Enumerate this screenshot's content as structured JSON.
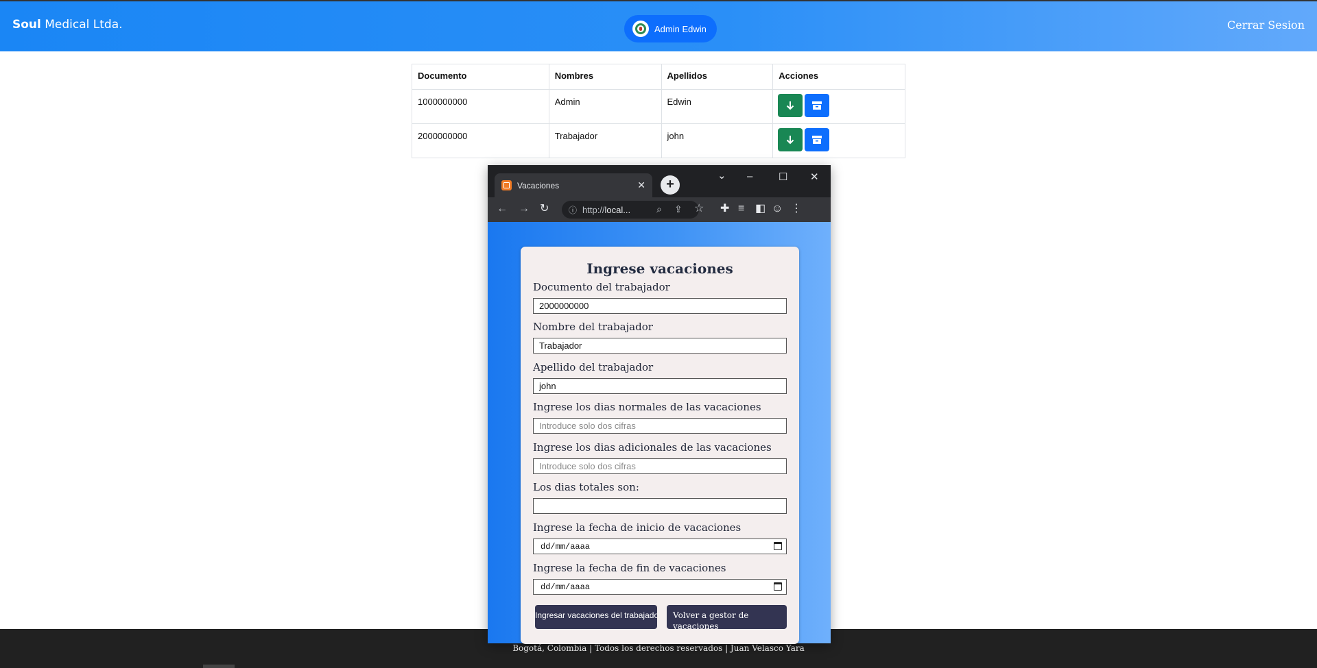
{
  "header": {
    "brand_bold": "Soul",
    "brand_rest": " Medical Ltda.",
    "user_label": "Admin Edwin",
    "logout_label": "Cerrar Sesion"
  },
  "table": {
    "headers": [
      "Documento",
      "Nombres",
      "Apellidos",
      "Acciones"
    ],
    "rows": [
      {
        "documento": "1000000000",
        "nombres": "Admin",
        "apellidos": "Edwin"
      },
      {
        "documento": "2000000000",
        "nombres": "Trabajador",
        "apellidos": "john"
      }
    ]
  },
  "browser": {
    "tab_title": "Vacaciones",
    "url_prefix": "http://",
    "url_host": "local..."
  },
  "form": {
    "title": "Ingrese vacaciones",
    "documento_label": "Documento del trabajador",
    "documento_value": "2000000000",
    "nombre_label": "Nombre del trabajador",
    "nombre_value": "Trabajador",
    "apellido_label": "Apellido del trabajador",
    "apellido_value": "john",
    "dias_normales_label": "Ingrese los dias normales de las vacaciones",
    "dias_normales_placeholder": "Introduce solo dos cifras",
    "dias_adicionales_label": "Ingrese los dias adicionales de las vacaciones",
    "dias_adicionales_placeholder": "Introduce solo dos cifras",
    "dias_totales_label": "Los dias totales son:",
    "dias_totales_value": "",
    "fecha_inicio_label": "Ingrese la fecha de inicio de vacaciones",
    "fecha_inicio_value": "dd/mm/aaaa",
    "fecha_fin_label": "Ingrese la fecha de fin de vacaciones",
    "fecha_fin_value": "dd/mm/aaaa",
    "submit_label": "Ingresar vacaciones del trabajador",
    "back_label": "Volver a gestor de vacaciones"
  },
  "footer": {
    "text": "Bogotá, Colombia | Todos los derechos reservados | Juan Velasco Yara"
  },
  "colors": {
    "navbar": "#1a86f5",
    "primary": "#0d6efd",
    "success": "#198754",
    "form_button": "#333452",
    "footer": "#212121"
  },
  "icons": [
    "avatar-icon",
    "download-icon",
    "archive-icon",
    "favicon-icon",
    "back-icon",
    "forward-icon",
    "reload-icon",
    "info-icon",
    "zoom-icon",
    "share-icon",
    "star-icon",
    "extensions-icon",
    "reading-list-icon",
    "sidebar-icon",
    "profile-icon",
    "menu-icon",
    "calendar-icon"
  ]
}
